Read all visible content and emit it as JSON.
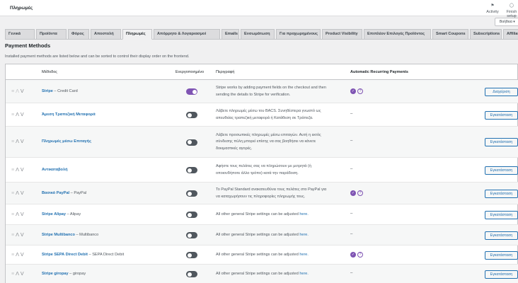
{
  "header": {
    "title": "Πληρωμές",
    "activity_label": "Activity",
    "finish_label": "Finish setup",
    "help_label": "Βοήθεια ▾"
  },
  "tabs": [
    {
      "label": "Γενικά",
      "active": false
    },
    {
      "label": "Προϊόντα",
      "active": false
    },
    {
      "label": "Φόρος",
      "active": false
    },
    {
      "label": "Αποστολή",
      "active": false
    },
    {
      "label": "Πληρωμές",
      "active": true
    },
    {
      "label": "Απόρρητο & Λογαριασμοί",
      "active": false
    },
    {
      "label": "Emails",
      "active": false
    },
    {
      "label": "Ενσωμάτωση",
      "active": false
    },
    {
      "label": "Για προχωρημένους",
      "active": false
    },
    {
      "label": "Product Visibility",
      "active": false
    },
    {
      "label": "Επιπλέον Επιλογές Προϊόντος",
      "active": false
    },
    {
      "label": "Smart Coupons",
      "active": false
    },
    {
      "label": "Subscriptions",
      "active": false
    },
    {
      "label": "Affiliate",
      "active": false
    }
  ],
  "section": {
    "title": "Payment Methods",
    "description": "Installed payment methods are listed below and can be sorted to control their display order on the frontend."
  },
  "columns": {
    "method": "Μέθοδος",
    "enabled": "Ενεργοποιημένο",
    "description": "Περιγραφή",
    "auto_recurring": "Automatic Recurring Payments"
  },
  "rows": [
    {
      "name": "Stripe",
      "sub": " – Credit Card",
      "enabled": true,
      "desc_lines": [
        "Stripe works by adding payment fields on the checkout and then",
        "sending the details to Stripe for verification."
      ],
      "desc_link": "",
      "recurring": true,
      "button": "Διαχείριση"
    },
    {
      "name": "Άμεση Τραπεζική Μεταφορά",
      "sub": "",
      "enabled": false,
      "desc_lines": [
        "Λάβετε πληρωμές μέσω του BACS. Συνηθέστερα γνωστό ως",
        "απευθείας τραπεζική μεταφορά ή Κατάθεση σε Τράπεζα."
      ],
      "desc_link": "",
      "recurring": false,
      "button": "Εγκατάσταση"
    },
    {
      "name": "Πληρωμές μέσω Επιταγής",
      "sub": "",
      "enabled": false,
      "desc_lines": [
        "Λάβετε προσωπικές πληρωμές μέσω επιταγών. Αυτή η εκτός",
        "σύνδεσης πύλη μπορεί επίσης να σας βοηθήσει να κάνετε",
        "δοκιμαστικές αγορές."
      ],
      "desc_link": "",
      "recurring": false,
      "button": "Εγκατάσταση"
    },
    {
      "name": "Αντικαταβολή",
      "sub": "",
      "enabled": false,
      "desc_lines": [
        "Αφήστε τους πελάτες σας να πληρώσουν με μετρητά (ή",
        "οποιονδήποτε άλλο τρόπο) κατά την παράδοση."
      ],
      "desc_link": "",
      "recurring": false,
      "button": "Εγκατάσταση"
    },
    {
      "name": "Βασικό PayPal",
      "sub": " – PayPal",
      "enabled": false,
      "desc_lines": [
        "Το PayPal Standard ανακατευθύνει τους πελάτες στο PayPal για",
        "να καταχωρήσουν τις πληροφορίες πληρωμής τους."
      ],
      "desc_link": "",
      "recurring": true,
      "button": "Εγκατάσταση"
    },
    {
      "name": "Stripe Alipay",
      "sub": " – Alipay",
      "enabled": false,
      "desc_lines": [
        "All other general Stripe settings can be adjusted "
      ],
      "desc_link": "here.",
      "recurring": false,
      "button": "Εγκατάσταση"
    },
    {
      "name": "Stripe Multibanco",
      "sub": " – Multibanco",
      "enabled": false,
      "desc_lines": [
        "All other general Stripe settings can be adjusted "
      ],
      "desc_link": "here.",
      "recurring": false,
      "button": "Εγκατάσταση"
    },
    {
      "name": "Stripe SEPA Direct Debit",
      "sub": " – SEPA Direct Debit",
      "enabled": false,
      "desc_lines": [
        "All other general Stripe settings can be adjusted "
      ],
      "desc_link": "here.",
      "recurring": true,
      "button": "Εγκατάσταση"
    },
    {
      "name": "Stripe giropay",
      "sub": " – giropay",
      "enabled": false,
      "desc_lines": [
        "All other general Stripe settings can be adjusted "
      ],
      "desc_link": "here.",
      "recurring": false,
      "button": "Εγκατάσταση"
    }
  ],
  "placeholders": {
    "no_recurring": "–",
    "check_glyph": "✓",
    "help_glyph": "?",
    "flag_glyph": "⚑",
    "circle_glyph": "◯",
    "drag_glyph": "≡",
    "up_glyph": "ᐱ",
    "down_glyph": "ᐯ"
  },
  "colors": {
    "accent": "#7f54b3",
    "link": "#2271b1"
  },
  "icons": [
    "flag-icon",
    "circle-progress-icon",
    "drag-handle-icon",
    "chevron-up-icon",
    "chevron-down-icon",
    "check-circle-icon",
    "help-circle-icon"
  ]
}
